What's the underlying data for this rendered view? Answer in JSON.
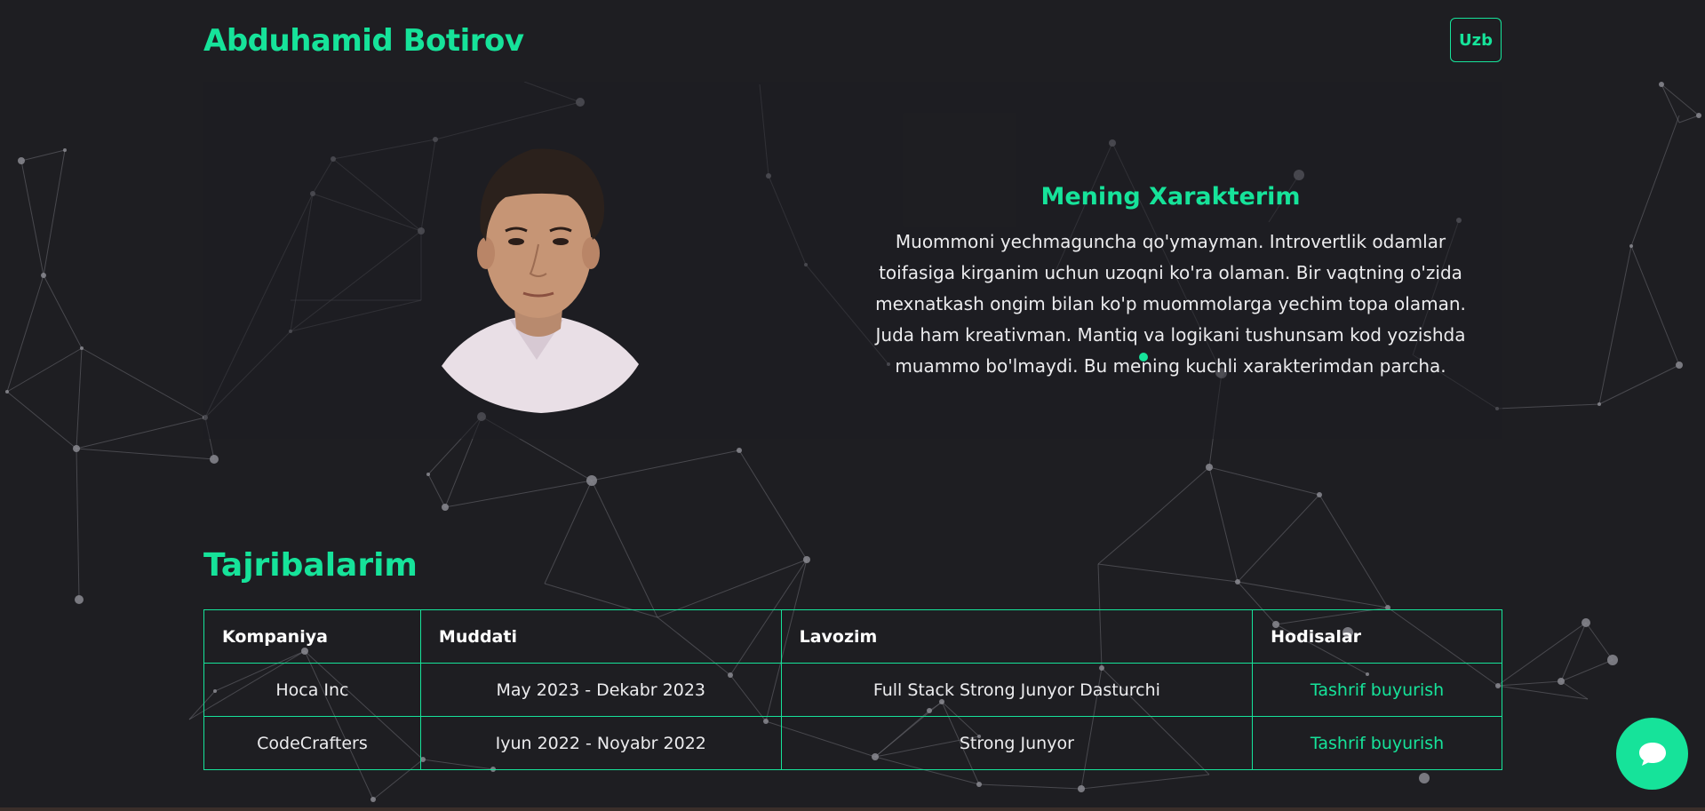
{
  "header": {
    "brand": "Abduhamid Botirov",
    "language_button": "Uzb"
  },
  "about": {
    "portrait_icon": "portrait-photo",
    "title": "Mening Xarakterim",
    "text": "Muommoni yechmaguncha qo'ymayman. Introvertlik odamlar toifasiga kirganim uchun uzoqni ko'ra olaman. Bir vaqtning o'zida mexnatkash ongim bilan ko'p muommolarga yechim topa olaman. Juda ham kreativman. Mantiq va logikani tushunsam kod yozishda muammo bo'lmaydi. Bu mening kuchli xarakterimdan parcha."
  },
  "experience": {
    "title": "Tajribalarim",
    "columns": [
      "Kompaniya",
      "Muddati",
      "Lavozim",
      "Hodisalar"
    ],
    "rows": [
      {
        "company": "Hoca Inc",
        "period": "May 2023 - Dekabr 2023",
        "position": "Full Stack Strong Junyor Dasturchi",
        "link": "Tashrif buyurish"
      },
      {
        "company": "CodeCrafters",
        "period": "Iyun 2022 - Noyabr 2022",
        "position": "Strong Junyor",
        "link": "Tashrif buyurish"
      }
    ]
  },
  "chat": {
    "icon": "chat-bubble-icon"
  },
  "colors": {
    "background": "#1e1e22",
    "accent": "#16e39a",
    "text": "#ececee"
  }
}
